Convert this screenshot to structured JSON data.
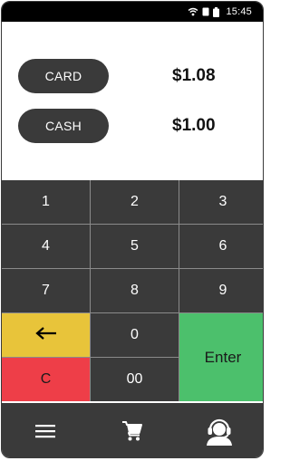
{
  "status_bar": {
    "time": "15:45",
    "icons": [
      "wifi-icon",
      "signal-icon",
      "battery-icon"
    ]
  },
  "payments": [
    {
      "label": "CARD",
      "amount": "$1.08"
    },
    {
      "label": "CASH",
      "amount": "$1.00"
    }
  ],
  "keypad": {
    "k1": "1",
    "k2": "2",
    "k3": "3",
    "k4": "4",
    "k5": "5",
    "k6": "6",
    "k7": "7",
    "k8": "8",
    "k9": "9",
    "k0": "0",
    "k00": "00",
    "clear": "C",
    "enter": "Enter",
    "backspace_icon": "left-arrow-icon"
  },
  "bottom_nav": {
    "icons": [
      "menu-icon",
      "cart-icon",
      "support-agent-icon"
    ]
  },
  "colors": {
    "dark": "#3a3a3a",
    "backspace": "#e8c43a",
    "clear": "#ee3e48",
    "enter": "#4cc06c"
  }
}
